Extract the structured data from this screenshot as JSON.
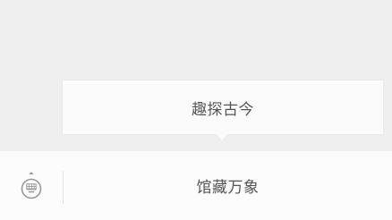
{
  "popup": {
    "item_label": "趣探古今"
  },
  "bottom_bar": {
    "keyboard_icon": "keyboard-toggle-icon",
    "menu_label": "馆藏万象"
  },
  "colors": {
    "background": "#efefef",
    "popup_bg": "#fbfbfb",
    "bottom_bar_bg": "#fcfcfc",
    "text": "#555555",
    "icon": "#999999"
  }
}
